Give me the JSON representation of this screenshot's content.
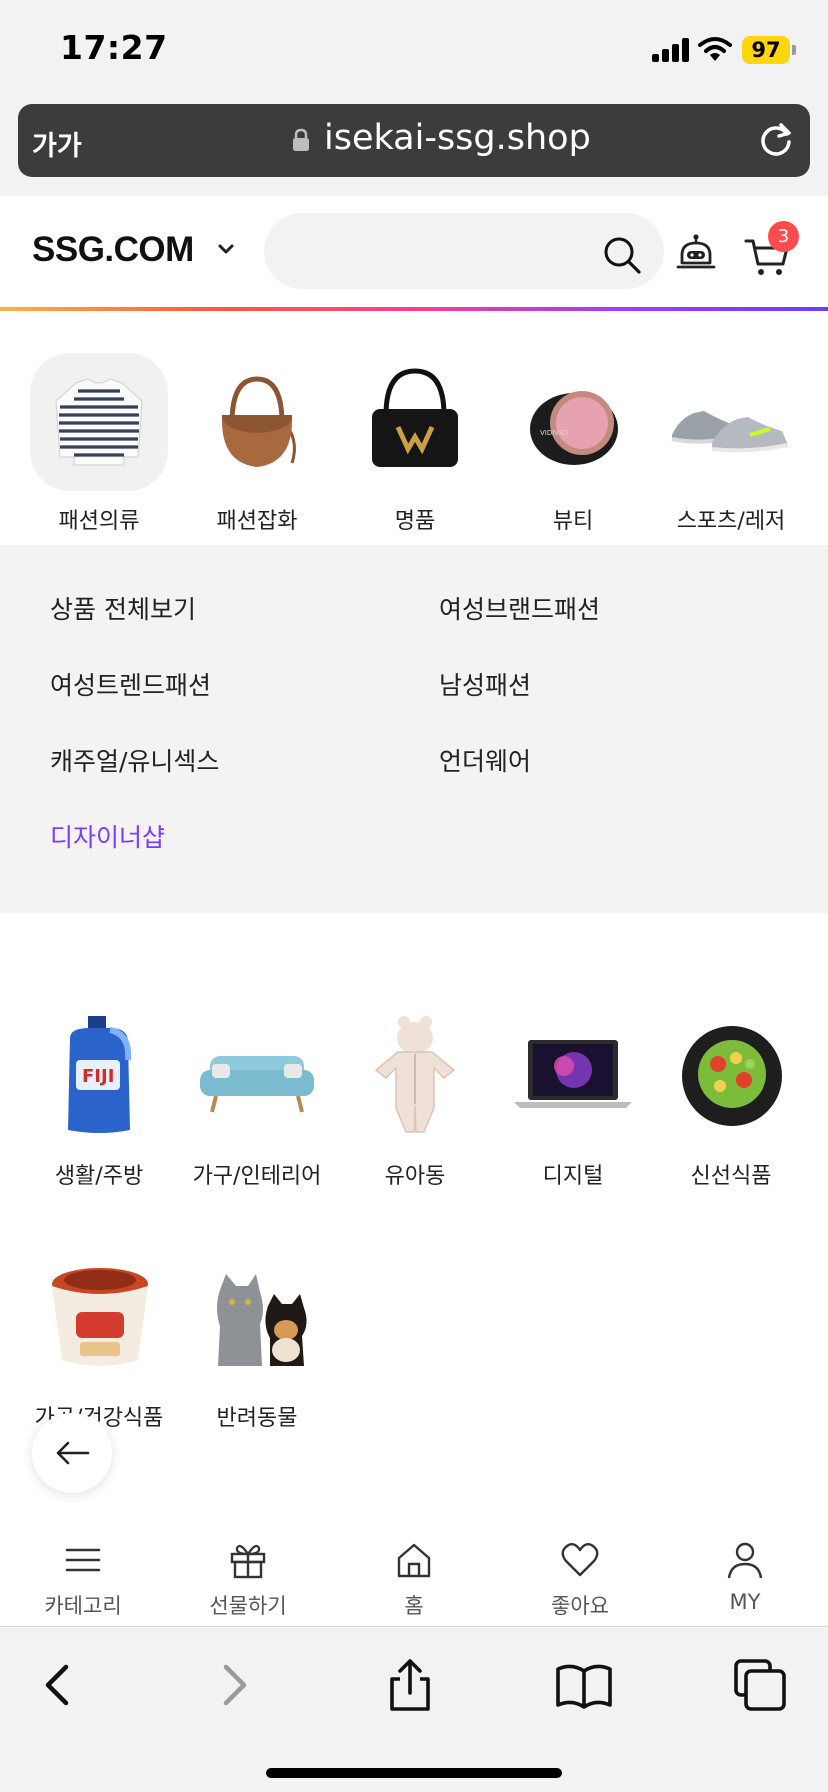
{
  "status_bar": {
    "time": "17:27",
    "battery": "97"
  },
  "browser": {
    "text_size_label": "가가",
    "url": "isekai-ssg.shop"
  },
  "header": {
    "logo": "SSG.COM",
    "cart_count": "3"
  },
  "categories_top": [
    {
      "label": "패션의류",
      "icon": "striped-shirt-icon",
      "selected": true
    },
    {
      "label": "패션잡화",
      "icon": "brown-handbag-icon",
      "selected": false
    },
    {
      "label": "명품",
      "icon": "luxury-bag-icon",
      "selected": false
    },
    {
      "label": "뷰티",
      "icon": "cushion-compact-icon",
      "selected": false
    },
    {
      "label": "스포츠/레저",
      "icon": "sneakers-icon",
      "selected": false
    }
  ],
  "submenu": {
    "items": [
      {
        "label": "상품 전체보기",
        "active": false
      },
      {
        "label": "여성브랜드패션",
        "active": false
      },
      {
        "label": "여성트렌드패션",
        "active": false
      },
      {
        "label": "남성패션",
        "active": false
      },
      {
        "label": "캐주얼/유니섹스",
        "active": false
      },
      {
        "label": "언더웨어",
        "active": false
      },
      {
        "label": "디자이너샵",
        "active": true
      }
    ]
  },
  "categories_middle": [
    {
      "label": "생활/주방",
      "icon": "detergent-bottle-icon"
    },
    {
      "label": "가구/인테리어",
      "icon": "sofa-icon"
    },
    {
      "label": "유아동",
      "icon": "baby-onesie-icon"
    },
    {
      "label": "디지털",
      "icon": "laptop-icon"
    },
    {
      "label": "신선식품",
      "icon": "salad-bowl-icon"
    }
  ],
  "categories_bottom": [
    {
      "label": "가공/건강식품",
      "icon": "kimchi-cup-icon"
    },
    {
      "label": "반려동물",
      "icon": "cat-and-dog-icon"
    }
  ],
  "tabbar": {
    "category": "카테고리",
    "gift": "선물하기",
    "home": "홈",
    "like": "좋아요",
    "my": "MY"
  },
  "colors": {
    "accent": "#7b3cff",
    "badge": "#ff4c4c",
    "battery": "#ffd60a"
  }
}
